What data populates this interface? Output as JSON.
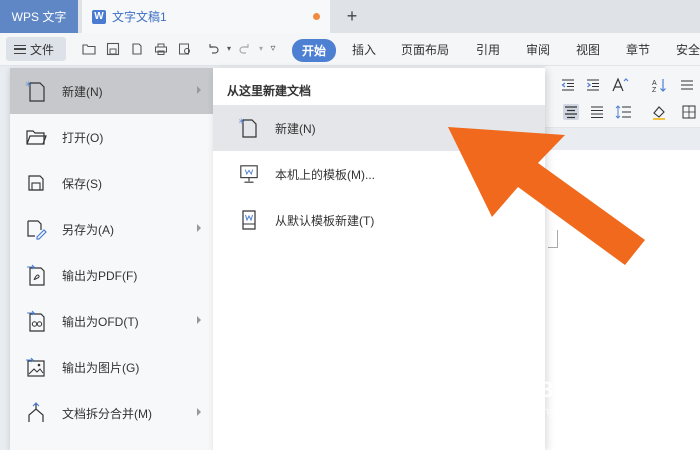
{
  "titlebar": {
    "app_tab": "WPS 文字",
    "doc_tab": "文字文稿1",
    "doc_icon": "W",
    "new_tab": "+"
  },
  "toolbar": {
    "file_menu_label": "文件",
    "ribbon_tabs": [
      "开始",
      "插入",
      "页面布局",
      "引用",
      "审阅",
      "视图",
      "章节",
      "安全"
    ],
    "active_tab": "开始",
    "accent_color": "#4d7fd3"
  },
  "file_menu": {
    "items": [
      {
        "label": "新建(N)",
        "icon": "new-doc-icon",
        "has_submenu": true,
        "active": true
      },
      {
        "label": "打开(O)",
        "icon": "folder-open-icon",
        "has_submenu": false
      },
      {
        "label": "保存(S)",
        "icon": "save-icon",
        "has_submenu": false
      },
      {
        "label": "另存为(A)",
        "icon": "save-as-icon",
        "has_submenu": true
      },
      {
        "label": "输出为PDF(F)",
        "icon": "export-pdf-icon",
        "has_submenu": false
      },
      {
        "label": "输出为OFD(T)",
        "icon": "export-ofd-icon",
        "has_submenu": true
      },
      {
        "label": "输出为图片(G)",
        "icon": "export-image-icon",
        "has_submenu": false
      },
      {
        "label": "文档拆分合并(M)",
        "icon": "split-merge-icon",
        "has_submenu": true
      }
    ]
  },
  "submenu": {
    "header": "从这里新建文档",
    "items": [
      {
        "label": "新建(N)",
        "icon": "new-doc-icon"
      },
      {
        "label": "本机上的模板(M)...",
        "icon": "local-template-icon"
      },
      {
        "label": "从默认模板新建(T)",
        "icon": "default-template-icon"
      }
    ]
  },
  "annotation": {
    "arrow_color": "#f0691c"
  },
  "watermark": {
    "logo": "Baidu 经验",
    "url": "jingyan.baidu.com"
  }
}
